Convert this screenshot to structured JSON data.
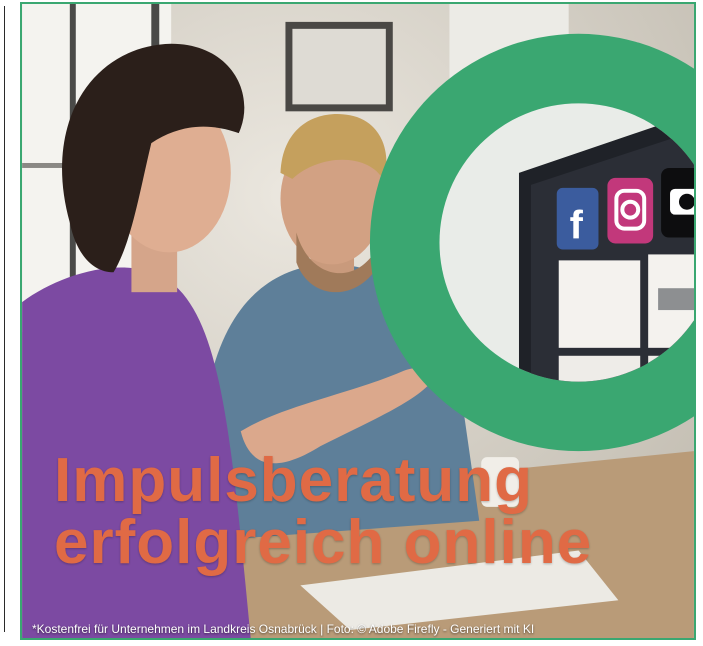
{
  "poster": {
    "headline_line1": "Impulsberatung",
    "headline_line2": "erfolgreich online",
    "footnote": "*Kostenfrei für Unternehmen im Landkreis Osnabrück  |  Foto: © Adobe Firefly - Generiert mit KI"
  },
  "colors": {
    "accent_green": "#3aa771",
    "headline_orange": "#e06a45",
    "footnote_text": "#ffffff"
  },
  "icons": [
    "facebook-icon",
    "instagram-icon",
    "camera-icon"
  ]
}
